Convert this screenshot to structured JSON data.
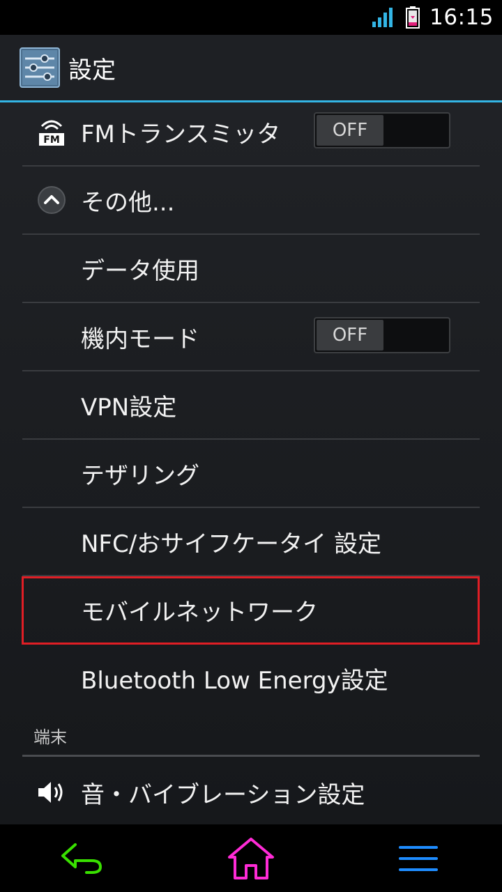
{
  "status_bar": {
    "time": "16:15"
  },
  "action_bar": {
    "title": "設定"
  },
  "settings": {
    "fm_transmitter": {
      "label": "FMトランスミッタ",
      "toggle": "OFF",
      "icon_text": "FM"
    },
    "more": {
      "label": "その他..."
    },
    "data_usage": {
      "label": "データ使用"
    },
    "airplane_mode": {
      "label": "機内モード",
      "toggle": "OFF"
    },
    "vpn": {
      "label": "VPN設定"
    },
    "tethering": {
      "label": "テザリング"
    },
    "nfc": {
      "label": "NFC/おサイフケータイ 設定"
    },
    "mobile_network": {
      "label": "モバイルネットワーク"
    },
    "bluetooth_le": {
      "label": "Bluetooth Low Energy設定"
    },
    "device_header": {
      "label": "端末"
    },
    "sound": {
      "label": "音・バイブレーション設定"
    }
  },
  "colors": {
    "accent": "#33b5e5",
    "highlight": "#e01e25",
    "nav_back": "#39e000",
    "nav_home": "#ff2bd6",
    "nav_menu": "#1e8cff"
  },
  "icons": {
    "signal": "signal-icon",
    "battery": "battery-icon",
    "app": "settings-sliders-icon",
    "fm": "fm-radio-icon",
    "more": "chevron-up-icon",
    "sound": "speaker-icon",
    "back": "back-arrow-icon",
    "home": "home-icon",
    "menu": "menu-icon"
  }
}
